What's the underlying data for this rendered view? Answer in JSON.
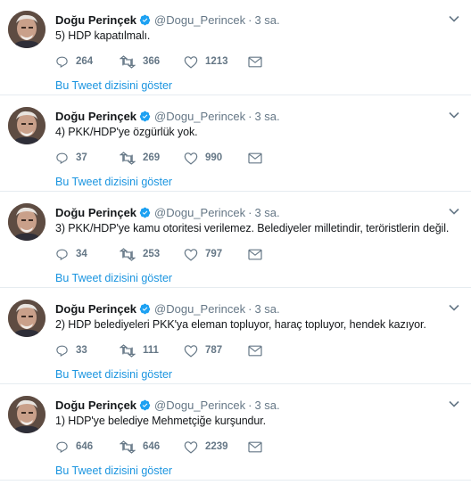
{
  "tweets": [
    {
      "name": "Doğu Perinçek",
      "handle": "@Dogu_Perincek",
      "time": "3 sa.",
      "text": "5) HDP kapatılmalı.",
      "replies": "264",
      "retweets": "366",
      "likes": "1213",
      "thread_link": "Bu Tweet dizisini göster"
    },
    {
      "name": "Doğu Perinçek",
      "handle": "@Dogu_Perincek",
      "time": "3 sa.",
      "text": "4) PKK/HDP'ye özgürlük yok.",
      "replies": "37",
      "retweets": "269",
      "likes": "990",
      "thread_link": "Bu Tweet dizisini göster"
    },
    {
      "name": "Doğu Perinçek",
      "handle": "@Dogu_Perincek",
      "time": "3 sa.",
      "text": "3) PKK/HDP'ye kamu otoritesi verilemez. Belediyeler milletindir, teröristlerin değil.",
      "replies": "34",
      "retweets": "253",
      "likes": "797",
      "thread_link": "Bu Tweet dizisini göster"
    },
    {
      "name": "Doğu Perinçek",
      "handle": "@Dogu_Perincek",
      "time": "3 sa.",
      "text": "2) HDP belediyeleri PKK'ya eleman topluyor, haraç topluyor, hendek kazıyor.",
      "replies": "33",
      "retweets": "111",
      "likes": "787",
      "thread_link": "Bu Tweet dizisini göster"
    },
    {
      "name": "Doğu Perinçek",
      "handle": "@Dogu_Perincek",
      "time": "3 sa.",
      "text": "1) HDP'ye belediye Mehmetçiğe kurşundur.",
      "replies": "646",
      "retweets": "646",
      "likes": "2239",
      "thread_link": "Bu Tweet dizisini göster"
    }
  ],
  "colors": {
    "link": "#1b95e0",
    "muted": "#657786",
    "verified": "#1da1f2",
    "text": "#14171a",
    "divider": "#e6ecf0"
  },
  "icons": {
    "reply": "reply-icon",
    "retweet": "retweet-icon",
    "like": "heart-icon",
    "dm": "envelope-icon",
    "verified": "verified-badge-icon",
    "more": "chevron-down-icon"
  }
}
